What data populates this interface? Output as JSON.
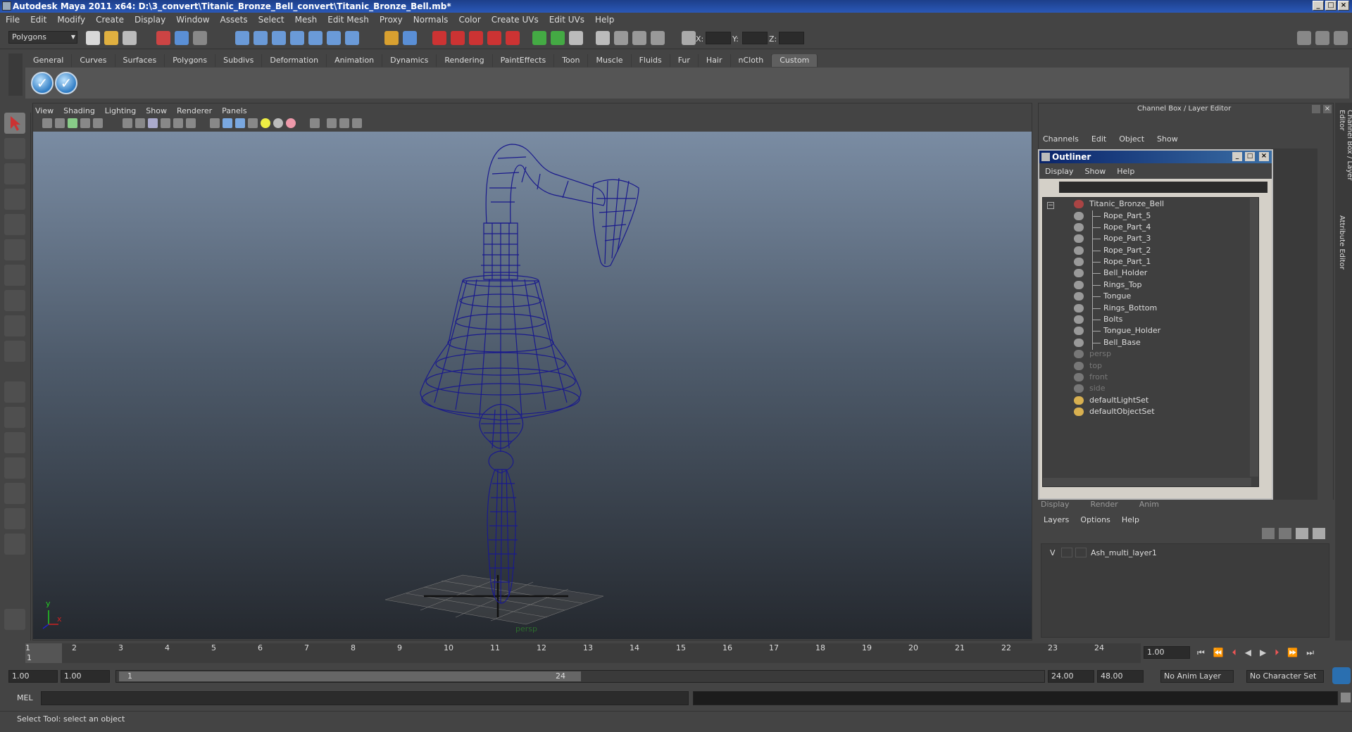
{
  "window": {
    "title": "Autodesk Maya 2011 x64: D:\\3_convert\\Titanic_Bronze_Bell_convert\\Titanic_Bronze_Bell.mb*",
    "buttons": [
      "_",
      "□",
      "×"
    ]
  },
  "menubar": [
    "File",
    "Edit",
    "Modify",
    "Create",
    "Display",
    "Window",
    "Assets",
    "Select",
    "Mesh",
    "Edit Mesh",
    "Proxy",
    "Normals",
    "Color",
    "Create UVs",
    "Edit UVs",
    "Help"
  ],
  "statusline": {
    "menu_set": "Polygons",
    "coord_labels": [
      "X:",
      "Y:",
      "Z:"
    ]
  },
  "shelf": {
    "tabs": [
      "General",
      "Curves",
      "Surfaces",
      "Polygons",
      "Subdivs",
      "Deformation",
      "Animation",
      "Dynamics",
      "Rendering",
      "PaintEffects",
      "Toon",
      "Muscle",
      "Fluids",
      "Fur",
      "Hair",
      "nCloth",
      "Custom"
    ],
    "active_tab": "Custom"
  },
  "viewport": {
    "menu": [
      "View",
      "Shading",
      "Lighting",
      "Show",
      "Renderer",
      "Panels"
    ],
    "camera_label": "persp",
    "axis_y": "y",
    "axis_x": "x"
  },
  "channelbox": {
    "title": "Channel Box / Layer Editor",
    "menu": [
      "Channels",
      "Edit",
      "Object",
      "Show"
    ],
    "side_tabs": [
      "Channel Box / Layer Editor",
      "Attribute Editor"
    ]
  },
  "outliner": {
    "title": "Outliner",
    "menu": [
      "Display",
      "Show",
      "Help"
    ],
    "root": "Titanic_Bronze_Bell",
    "children": [
      "Rope_Part_5",
      "Rope_Part_4",
      "Rope_Part_3",
      "Rope_Part_2",
      "Rope_Part_1",
      "Bell_Holder",
      "Rings_Top",
      "Tongue",
      "Rings_Bottom",
      "Bolts",
      "Tongue_Holder",
      "Bell_Base"
    ],
    "cameras": [
      "persp",
      "top",
      "front",
      "side"
    ],
    "sets": [
      "defaultLightSet",
      "defaultObjectSet"
    ]
  },
  "layer_editor": {
    "tabs": [
      "Display",
      "Render",
      "Anim"
    ],
    "menu": [
      "Layers",
      "Options",
      "Help"
    ],
    "layer_visibility": "V",
    "layer_name": "Ash_multi_layer1"
  },
  "timeline": {
    "ticks": [
      "1",
      "2",
      "3",
      "4",
      "5",
      "6",
      "7",
      "8",
      "9",
      "10",
      "11",
      "12",
      "13",
      "14",
      "15",
      "16",
      "17",
      "18",
      "19",
      "20",
      "21",
      "22",
      "23",
      "24"
    ],
    "current_frame_marker": "1",
    "current_time": "1.00"
  },
  "range": {
    "start": "1.00",
    "playback_start": "1.00",
    "slider_start": "1",
    "slider_end": "24",
    "playback_end": "24.00",
    "end": "48.00",
    "anim_layer": "No Anim Layer",
    "character_set": "No Character Set"
  },
  "command": {
    "label": "MEL"
  },
  "help": {
    "text": "Select Tool: select an object"
  }
}
